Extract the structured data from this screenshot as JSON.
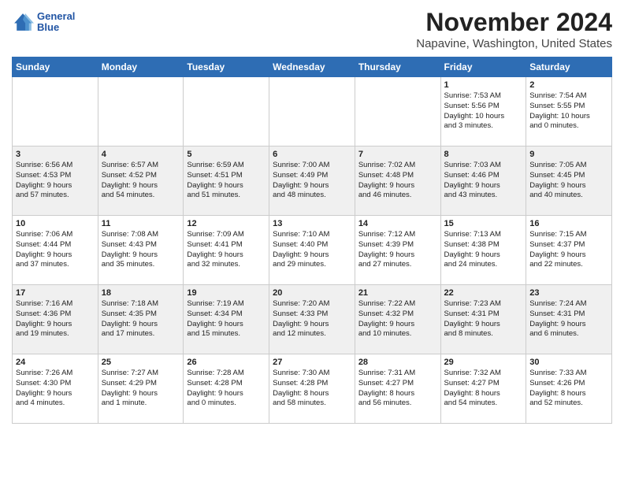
{
  "header": {
    "logo": {
      "line1": "General",
      "line2": "Blue"
    },
    "title": "November 2024",
    "subtitle": "Napavine, Washington, United States"
  },
  "weekdays": [
    "Sunday",
    "Monday",
    "Tuesday",
    "Wednesday",
    "Thursday",
    "Friday",
    "Saturday"
  ],
  "weeks": [
    [
      {
        "day": "",
        "info": ""
      },
      {
        "day": "",
        "info": ""
      },
      {
        "day": "",
        "info": ""
      },
      {
        "day": "",
        "info": ""
      },
      {
        "day": "",
        "info": ""
      },
      {
        "day": "1",
        "info": "Sunrise: 7:53 AM\nSunset: 5:56 PM\nDaylight: 10 hours\nand 3 minutes."
      },
      {
        "day": "2",
        "info": "Sunrise: 7:54 AM\nSunset: 5:55 PM\nDaylight: 10 hours\nand 0 minutes."
      }
    ],
    [
      {
        "day": "3",
        "info": "Sunrise: 6:56 AM\nSunset: 4:53 PM\nDaylight: 9 hours\nand 57 minutes."
      },
      {
        "day": "4",
        "info": "Sunrise: 6:57 AM\nSunset: 4:52 PM\nDaylight: 9 hours\nand 54 minutes."
      },
      {
        "day": "5",
        "info": "Sunrise: 6:59 AM\nSunset: 4:51 PM\nDaylight: 9 hours\nand 51 minutes."
      },
      {
        "day": "6",
        "info": "Sunrise: 7:00 AM\nSunset: 4:49 PM\nDaylight: 9 hours\nand 48 minutes."
      },
      {
        "day": "7",
        "info": "Sunrise: 7:02 AM\nSunset: 4:48 PM\nDaylight: 9 hours\nand 46 minutes."
      },
      {
        "day": "8",
        "info": "Sunrise: 7:03 AM\nSunset: 4:46 PM\nDaylight: 9 hours\nand 43 minutes."
      },
      {
        "day": "9",
        "info": "Sunrise: 7:05 AM\nSunset: 4:45 PM\nDaylight: 9 hours\nand 40 minutes."
      }
    ],
    [
      {
        "day": "10",
        "info": "Sunrise: 7:06 AM\nSunset: 4:44 PM\nDaylight: 9 hours\nand 37 minutes."
      },
      {
        "day": "11",
        "info": "Sunrise: 7:08 AM\nSunset: 4:43 PM\nDaylight: 9 hours\nand 35 minutes."
      },
      {
        "day": "12",
        "info": "Sunrise: 7:09 AM\nSunset: 4:41 PM\nDaylight: 9 hours\nand 32 minutes."
      },
      {
        "day": "13",
        "info": "Sunrise: 7:10 AM\nSunset: 4:40 PM\nDaylight: 9 hours\nand 29 minutes."
      },
      {
        "day": "14",
        "info": "Sunrise: 7:12 AM\nSunset: 4:39 PM\nDaylight: 9 hours\nand 27 minutes."
      },
      {
        "day": "15",
        "info": "Sunrise: 7:13 AM\nSunset: 4:38 PM\nDaylight: 9 hours\nand 24 minutes."
      },
      {
        "day": "16",
        "info": "Sunrise: 7:15 AM\nSunset: 4:37 PM\nDaylight: 9 hours\nand 22 minutes."
      }
    ],
    [
      {
        "day": "17",
        "info": "Sunrise: 7:16 AM\nSunset: 4:36 PM\nDaylight: 9 hours\nand 19 minutes."
      },
      {
        "day": "18",
        "info": "Sunrise: 7:18 AM\nSunset: 4:35 PM\nDaylight: 9 hours\nand 17 minutes."
      },
      {
        "day": "19",
        "info": "Sunrise: 7:19 AM\nSunset: 4:34 PM\nDaylight: 9 hours\nand 15 minutes."
      },
      {
        "day": "20",
        "info": "Sunrise: 7:20 AM\nSunset: 4:33 PM\nDaylight: 9 hours\nand 12 minutes."
      },
      {
        "day": "21",
        "info": "Sunrise: 7:22 AM\nSunset: 4:32 PM\nDaylight: 9 hours\nand 10 minutes."
      },
      {
        "day": "22",
        "info": "Sunrise: 7:23 AM\nSunset: 4:31 PM\nDaylight: 9 hours\nand 8 minutes."
      },
      {
        "day": "23",
        "info": "Sunrise: 7:24 AM\nSunset: 4:31 PM\nDaylight: 9 hours\nand 6 minutes."
      }
    ],
    [
      {
        "day": "24",
        "info": "Sunrise: 7:26 AM\nSunset: 4:30 PM\nDaylight: 9 hours\nand 4 minutes."
      },
      {
        "day": "25",
        "info": "Sunrise: 7:27 AM\nSunset: 4:29 PM\nDaylight: 9 hours\nand 1 minute."
      },
      {
        "day": "26",
        "info": "Sunrise: 7:28 AM\nSunset: 4:28 PM\nDaylight: 9 hours\nand 0 minutes."
      },
      {
        "day": "27",
        "info": "Sunrise: 7:30 AM\nSunset: 4:28 PM\nDaylight: 8 hours\nand 58 minutes."
      },
      {
        "day": "28",
        "info": "Sunrise: 7:31 AM\nSunset: 4:27 PM\nDaylight: 8 hours\nand 56 minutes."
      },
      {
        "day": "29",
        "info": "Sunrise: 7:32 AM\nSunset: 4:27 PM\nDaylight: 8 hours\nand 54 minutes."
      },
      {
        "day": "30",
        "info": "Sunrise: 7:33 AM\nSunset: 4:26 PM\nDaylight: 8 hours\nand 52 minutes."
      }
    ]
  ]
}
